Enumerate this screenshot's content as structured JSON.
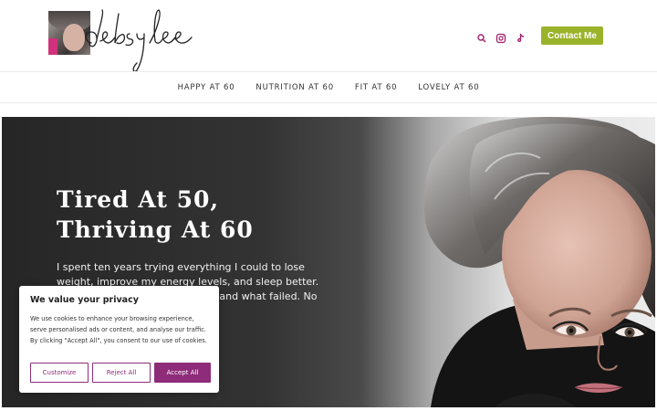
{
  "header": {
    "logo_text": "debsylee",
    "contact_label": "Contact Me",
    "icons": [
      "search-icon",
      "instagram-icon",
      "tiktok-icon"
    ]
  },
  "nav": {
    "items": [
      {
        "label": "HAPPY AT 60"
      },
      {
        "label": "NUTRITION AT 60"
      },
      {
        "label": "FIT AT 60"
      },
      {
        "label": "LOVELY AT 60"
      }
    ]
  },
  "hero": {
    "title_line1": "Tired At 50,",
    "title_line2": "Thriving At 60",
    "text": "I spent ten years trying everything I could to lose weight, improve my energy levels, and sleep better. This is my story of what worked and what failed. No BS."
  },
  "cookie": {
    "title": "We value your privacy",
    "text": "We use cookies to enhance your browsing experience, serve personalised ads or content, and analyse our traffic. By clicking \"Accept All\", you consent to our use of cookies.",
    "customize": "Customize",
    "reject": "Reject All",
    "accept": "Accept All"
  },
  "colors": {
    "accent_green": "#9bb22b",
    "accent_purple": "#8e2c7a",
    "icon_pink": "#a3206e"
  }
}
